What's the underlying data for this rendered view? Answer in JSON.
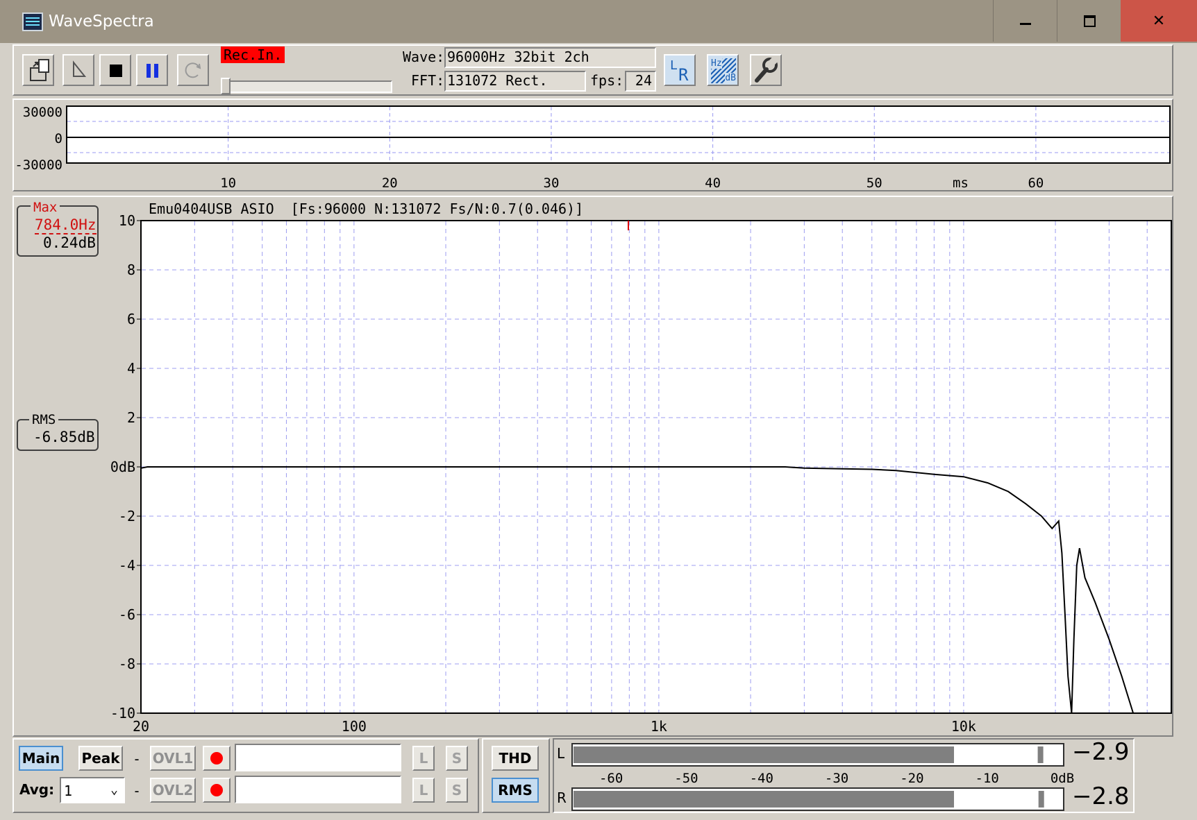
{
  "window": {
    "title": "WaveSpectra",
    "controls": [
      "minimize",
      "maximize",
      "close"
    ]
  },
  "toolbar": {
    "rec_indicator": "Rec.In.",
    "wave_label": "Wave:",
    "wave_value": "96000Hz 32bit 2ch",
    "fft_label": "FFT:",
    "fft_value": "131072 Rect.",
    "fps_label": "fps:",
    "fps_value": "24",
    "lr_icon_text": [
      "L",
      "R"
    ],
    "hzdb_icon_text": [
      "Hz",
      "dB"
    ]
  },
  "wave_panel": {
    "y_ticks": [
      "30000",
      "0",
      "-30000"
    ],
    "x_ticks": [
      "10",
      "20",
      "30",
      "40",
      "50",
      "60"
    ],
    "x_unit": "ms"
  },
  "spectrum": {
    "header": "Emu0404USB ASIO  [Fs:96000 N:131072 Fs/N:0.7(0.046)]",
    "max_label": "Max",
    "max_freq": "784.0Hz",
    "max_db": "0.24dB",
    "rms_label": "RMS",
    "rms_value": "-6.85dB"
  },
  "bottom": {
    "main_label": "Main",
    "peak_label": "Peak",
    "dash": "-",
    "ovl1_label": "OVL1",
    "ovl2_label": "OVL2",
    "avg_label": "Avg:",
    "avg_value": "1",
    "l_label": "L",
    "s_label": "S",
    "thd_label": "THD",
    "rms_label": "RMS"
  },
  "meter": {
    "left_label": "L",
    "right_label": "R",
    "left_value": "−2.9",
    "right_value": "−2.8",
    "scale": [
      "-60",
      "-50",
      "-40",
      "-30",
      "-20",
      "-10",
      "0dB"
    ],
    "left_level_db": -14.4,
    "right_level_db": -14.4,
    "left_peak_db": -2.9,
    "right_peak_db": -2.8
  },
  "chart_data": {
    "type": "line",
    "title": "Emu0404USB ASIO  [Fs:96000 N:131072 Fs/N:0.7(0.046)]",
    "xlabel": "",
    "ylabel": "",
    "x_scale": "log",
    "xlim": [
      20,
      48000
    ],
    "ylim": [
      -10,
      10
    ],
    "x_tick_labels": [
      "20",
      "100",
      "1k",
      "10k"
    ],
    "y_tick_labels": [
      "10",
      "8",
      "6",
      "4",
      "2",
      "0dB",
      "-2",
      "-4",
      "-6",
      "-8",
      "-10"
    ],
    "grid": true,
    "series": [
      {
        "x": [
          20,
          21,
          22,
          50,
          100,
          500,
          1000,
          2000,
          2600,
          3000,
          4000,
          5000,
          6000,
          8000,
          10000,
          12000,
          14000,
          16000,
          18000,
          19500,
          20500,
          21000,
          21500,
          22000,
          22600,
          23000,
          23500,
          24000,
          25000,
          27000,
          30000,
          33000,
          36000,
          38000
        ],
        "y": [
          -0.05,
          0.0,
          0.0,
          0.0,
          0.0,
          0.0,
          0.0,
          0.0,
          0.0,
          -0.05,
          -0.08,
          -0.1,
          -0.15,
          -0.3,
          -0.4,
          -0.65,
          -1.0,
          -1.5,
          -2.0,
          -2.5,
          -2.2,
          -3.5,
          -6.0,
          -8.5,
          -10.0,
          -7.0,
          -4.0,
          -3.3,
          -4.5,
          -5.5,
          -7.0,
          -8.5,
          -10.0,
          -10.0
        ]
      }
    ]
  }
}
